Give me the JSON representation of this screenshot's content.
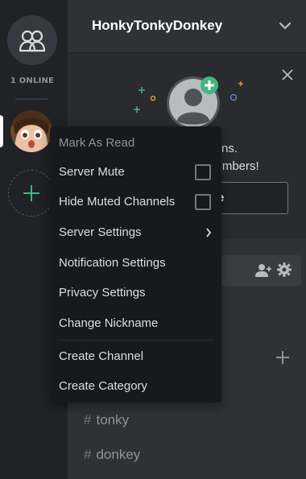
{
  "rail": {
    "online_label": "1 ONLINE"
  },
  "header": {
    "server_name": "HonkyTonkyDonkey"
  },
  "invite": {
    "text_line1": "egins.",
    "text_line2": "members!",
    "button_label": "e"
  },
  "channels": [
    {
      "name": "tonky"
    },
    {
      "name": "donkey"
    }
  ],
  "menu": {
    "items": [
      {
        "label": "Mark As Read"
      },
      {
        "label": "Server Mute"
      },
      {
        "label": "Hide Muted Channels"
      },
      {
        "label": "Server Settings"
      },
      {
        "label": "Notification Settings"
      },
      {
        "label": "Privacy Settings"
      },
      {
        "label": "Change Nickname"
      },
      {
        "label": "Create Channel"
      },
      {
        "label": "Create Category"
      }
    ]
  },
  "colors": {
    "rail_bg": "#202225",
    "channels_bg": "#2f3136",
    "menu_bg": "#18191c",
    "accent_green": "#43b581",
    "online_green": "#43b581"
  }
}
